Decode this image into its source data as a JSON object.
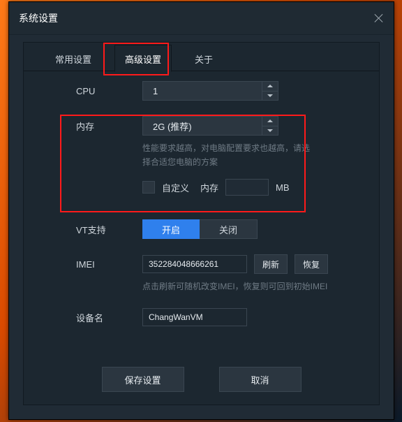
{
  "window": {
    "title": "系统设置"
  },
  "tabs": {
    "common": "常用设置",
    "advanced": "高级设置",
    "about": "关于"
  },
  "labels": {
    "cpu": "CPU",
    "memory": "内存",
    "vt": "VT支持",
    "imei": "IMEI",
    "device": "设备名",
    "custom": "自定义",
    "mem_word": "内存",
    "mb": "MB"
  },
  "values": {
    "cpu": "1",
    "memory": "2G (推荐)",
    "imei": "352284048666261",
    "device": "ChangWanVM"
  },
  "hints": {
    "memory": "性能要求越高，对电脑配置要求也越高，请选择合适您电脑的方案",
    "imei": "点击刷新可随机改变IMEI，恢复则可回到初始IMEI"
  },
  "buttons": {
    "vt_on": "开启",
    "vt_off": "关闭",
    "refresh_imei": "刷新",
    "restore_imei": "恢复",
    "save": "保存设置",
    "cancel": "取消"
  }
}
